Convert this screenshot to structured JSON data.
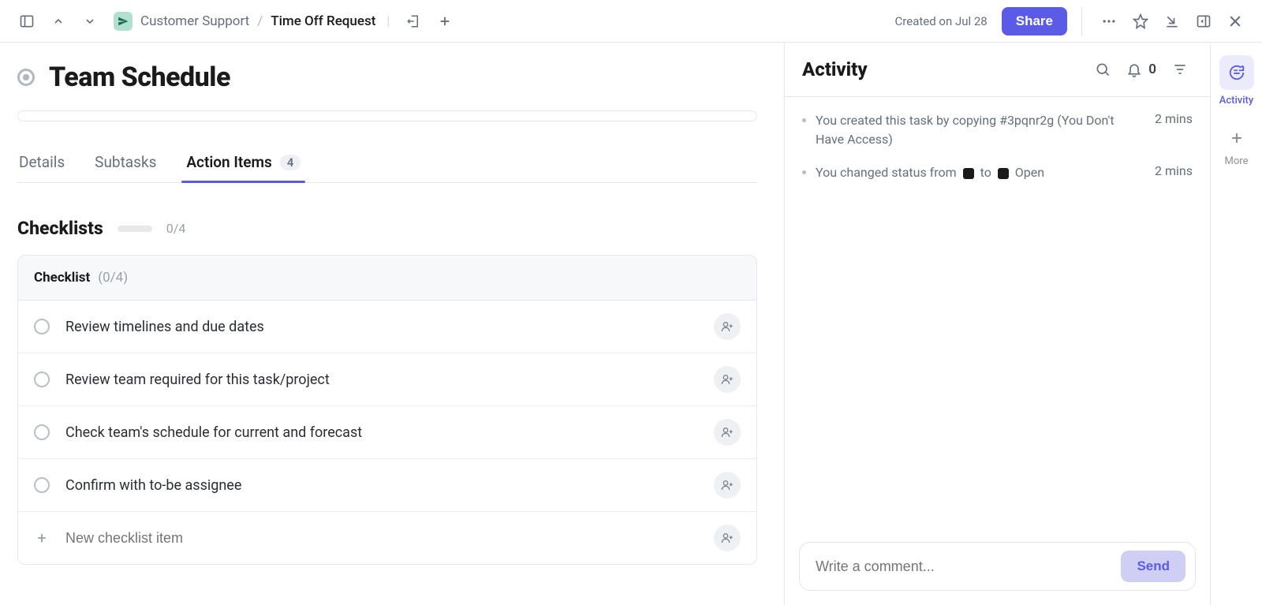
{
  "topbar": {
    "space": "Customer Support",
    "page": "Time Off Request",
    "created": "Created on Jul 28",
    "share": "Share"
  },
  "title": "Team Schedule",
  "tabs": {
    "details": "Details",
    "subtasks": "Subtasks",
    "action_items": "Action Items",
    "action_items_count": "4"
  },
  "checklists": {
    "heading": "Checklists",
    "overall": "0/4",
    "group": {
      "name": "Checklist",
      "count": "(0/4)",
      "items": [
        "Review timelines and due dates",
        "Review team required for this task/project",
        "Check team's schedule for current and forecast",
        "Confirm with to-be assignee"
      ],
      "new_placeholder": "New checklist item"
    }
  },
  "activity": {
    "heading": "Activity",
    "notif_count": "0",
    "entries": [
      {
        "text_pre": "You created this task by copying #3pqnr2g (You Don't Have Access)",
        "time": "2 mins",
        "type": "plain"
      },
      {
        "text_pre": "You changed status from ",
        "text_mid": " to ",
        "text_post": " Open",
        "time": "2 mins",
        "type": "status"
      }
    ],
    "comment_placeholder": "Write a comment...",
    "send": "Send"
  },
  "rail": {
    "activity": "Activity",
    "more": "More"
  }
}
